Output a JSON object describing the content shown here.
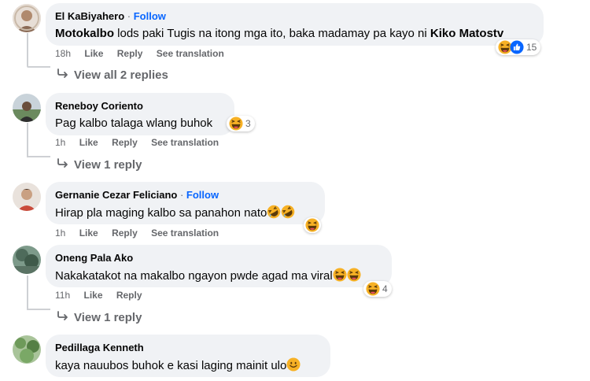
{
  "comments": [
    {
      "author": "El KaBiyahero",
      "follow": "Follow",
      "tag1": "Motokalbo",
      "text": " lods paki Tugis na itong mga ito, baka madamay pa kayo ni ",
      "tag2": "Kiko Matostv",
      "time": "18h",
      "like": "Like",
      "reply": "Reply",
      "translate": "See translation",
      "reaction_count": "15",
      "replies": "View all 2 replies"
    },
    {
      "author": "Reneboy Coriento",
      "text": "Pag kalbo talaga wlang buhok",
      "time": "1h",
      "like": "Like",
      "reply": "Reply",
      "translate": "See translation",
      "reaction_count": "3",
      "replies": "View 1 reply"
    },
    {
      "author": "Gernanie Cezar Feliciano",
      "follow": "Follow",
      "text": "Hirap pla maging kalbo sa panahon nato",
      "time": "1h",
      "like": "Like",
      "reply": "Reply",
      "translate": "See translation"
    },
    {
      "author": "Oneng Pala Ako",
      "text": "Nakakatakot na makalbo ngayon pwde agad ma viral",
      "time": "11h",
      "like": "Like",
      "reply": "Reply",
      "reaction_count": "4",
      "replies": "View 1 reply"
    },
    {
      "author": "Pedillaga Kenneth",
      "text": "kaya nauubos buhok e kasi laging mainit ulo"
    }
  ],
  "colors": {
    "link": "#0866ff",
    "bubble": "#f0f2f5",
    "meta": "#65676b"
  }
}
